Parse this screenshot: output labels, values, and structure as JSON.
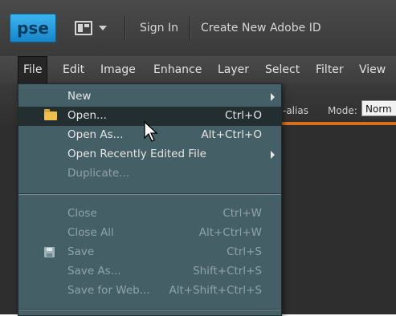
{
  "titlebar": {
    "logo": "pse",
    "sign_in": "Sign In",
    "create_id": "Create New Adobe ID"
  },
  "menubar": {
    "items": [
      "File",
      "Edit",
      "Image",
      "Enhance",
      "Layer",
      "Select",
      "Filter",
      "View"
    ]
  },
  "options": {
    "alias_text": "-alias",
    "mode_label": "Mode:",
    "mode_value": "Norm"
  },
  "file_menu": {
    "items": [
      {
        "label": "New",
        "shortcut": "",
        "submenu": true,
        "enabled": true
      },
      {
        "label": "Open...",
        "shortcut": "Ctrl+O",
        "submenu": false,
        "enabled": true,
        "icon": "folder-icon"
      },
      {
        "label": "Open As...",
        "shortcut": "Alt+Ctrl+O",
        "submenu": false,
        "enabled": true
      },
      {
        "label": "Open Recently Edited File",
        "shortcut": "",
        "submenu": true,
        "enabled": true
      },
      {
        "label": "Duplicate...",
        "shortcut": "",
        "submenu": false,
        "enabled": false
      },
      {
        "label": "Close",
        "shortcut": "Ctrl+W",
        "submenu": false,
        "enabled": false
      },
      {
        "label": "Close All",
        "shortcut": "Alt+Ctrl+W",
        "submenu": false,
        "enabled": false
      },
      {
        "label": "Save",
        "shortcut": "Ctrl+S",
        "submenu": false,
        "enabled": false,
        "icon": "floppy-icon"
      },
      {
        "label": "Save As...",
        "shortcut": "Shift+Ctrl+S",
        "submenu": false,
        "enabled": false
      },
      {
        "label": "Save for Web...",
        "shortcut": "Alt+Shift+Ctrl+S",
        "submenu": false,
        "enabled": false
      }
    ]
  },
  "colors": {
    "accent_orange": "#d9701e",
    "logo_blue": "#1783c7",
    "menu_bg": "#456168"
  }
}
